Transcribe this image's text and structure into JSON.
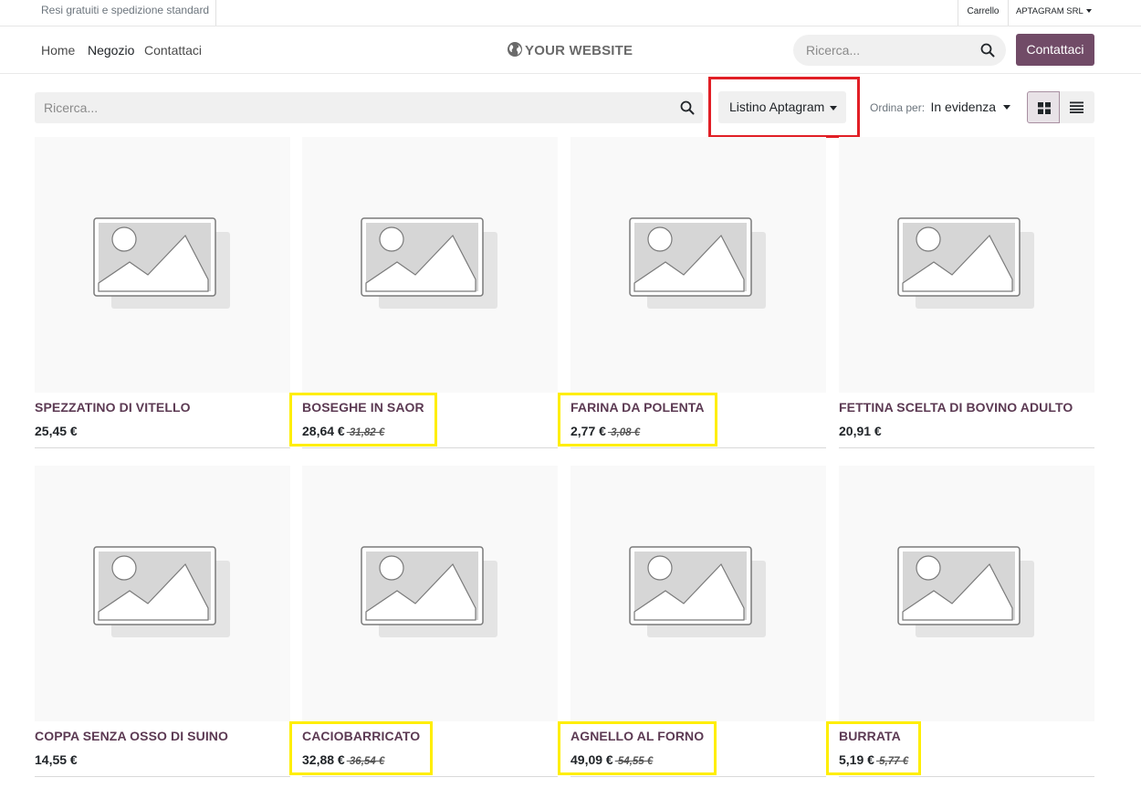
{
  "topbar": {
    "promo": "Resi gratuiti e spedizione standard",
    "cart": "Carrello",
    "company": "APTAGRAM SRL"
  },
  "navbar": {
    "links": [
      "Home",
      "Negozio",
      "Contattaci"
    ],
    "active": "Negozio",
    "brand": "YOUR WEBSITE",
    "search_placeholder": "Ricerca...",
    "cta": "Contattaci"
  },
  "filters": {
    "search_placeholder": "Ricerca...",
    "pricelist": "Listino Aptagram",
    "sort_label": "Ordina per:",
    "sort_value": "In evidenza"
  },
  "products": [
    {
      "name": "SPEZZATINO DI VITELLO",
      "price": "25,45 €",
      "old_price": "",
      "highlighted": false
    },
    {
      "name": "BOSEGHE IN SAOR",
      "price": "28,64 €",
      "old_price": "31,82 €",
      "highlighted": true
    },
    {
      "name": "FARINA DA POLENTA",
      "price": "2,77 €",
      "old_price": "3,08 €",
      "highlighted": true
    },
    {
      "name": "FETTINA SCELTA DI BOVINO ADULTO",
      "price": "20,91 €",
      "old_price": "",
      "highlighted": false
    },
    {
      "name": "COPPA SENZA OSSO DI SUINO",
      "price": "14,55 €",
      "old_price": "",
      "highlighted": false
    },
    {
      "name": "CACIOBARRICATO",
      "price": "32,88 €",
      "old_price": "36,54 €",
      "highlighted": true
    },
    {
      "name": "AGNELLO AL FORNO",
      "price": "49,09 €",
      "old_price": "54,55 €",
      "highlighted": true
    },
    {
      "name": "BURRATA",
      "price": "5,19 €",
      "old_price": "5,77 €",
      "highlighted": true
    }
  ],
  "colors": {
    "brand_primary": "#714b67",
    "product_title": "#5c3a53",
    "annotation_red": "#e11f26",
    "annotation_yellow": "#ffee00"
  }
}
